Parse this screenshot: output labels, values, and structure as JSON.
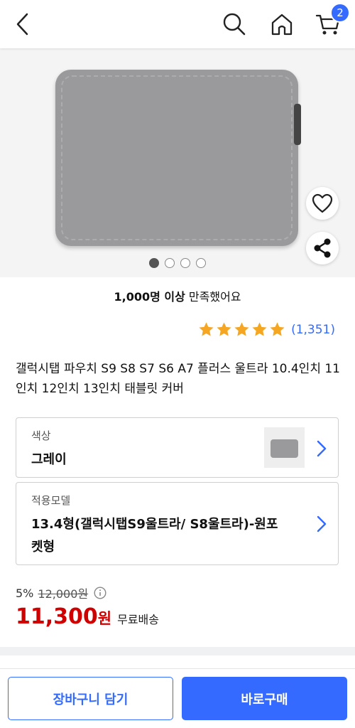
{
  "header": {
    "back_icon": "chevron-left-icon",
    "search_icon": "search-icon",
    "home_icon": "home-icon",
    "cart_icon": "cart-icon",
    "cart_count": "2",
    "accent": "#346aff"
  },
  "gallery": {
    "image_count": 4,
    "active_index": 0,
    "like_icon": "heart-icon",
    "share_icon": "share-icon"
  },
  "satisfaction": {
    "bold": "1,000명 이상",
    "rest": " 만족했어요"
  },
  "rating": {
    "stars": 5,
    "count": "(1,351)",
    "star_color": "#f5a623"
  },
  "product": {
    "title": "갤럭시탭 파우치 S9 S8 S7 S6 A7 플러스 울트라 10.4인치 11인치 12인치 13인치 태블릿 커버"
  },
  "options": [
    {
      "label": "색상",
      "value": "그레이"
    },
    {
      "label": "적용모델",
      "value": "13.4형(갤럭시탭S9울트라/ S8울트라)-원포켓형"
    }
  ],
  "price": {
    "discount": "5%",
    "original": "12,000원",
    "sale": "11,300",
    "currency": "원",
    "shipping": "무료배송",
    "sale_color": "#d00000"
  },
  "actions": {
    "add_to_cart": "장바구니 담기",
    "buy_now": "바로구매"
  }
}
